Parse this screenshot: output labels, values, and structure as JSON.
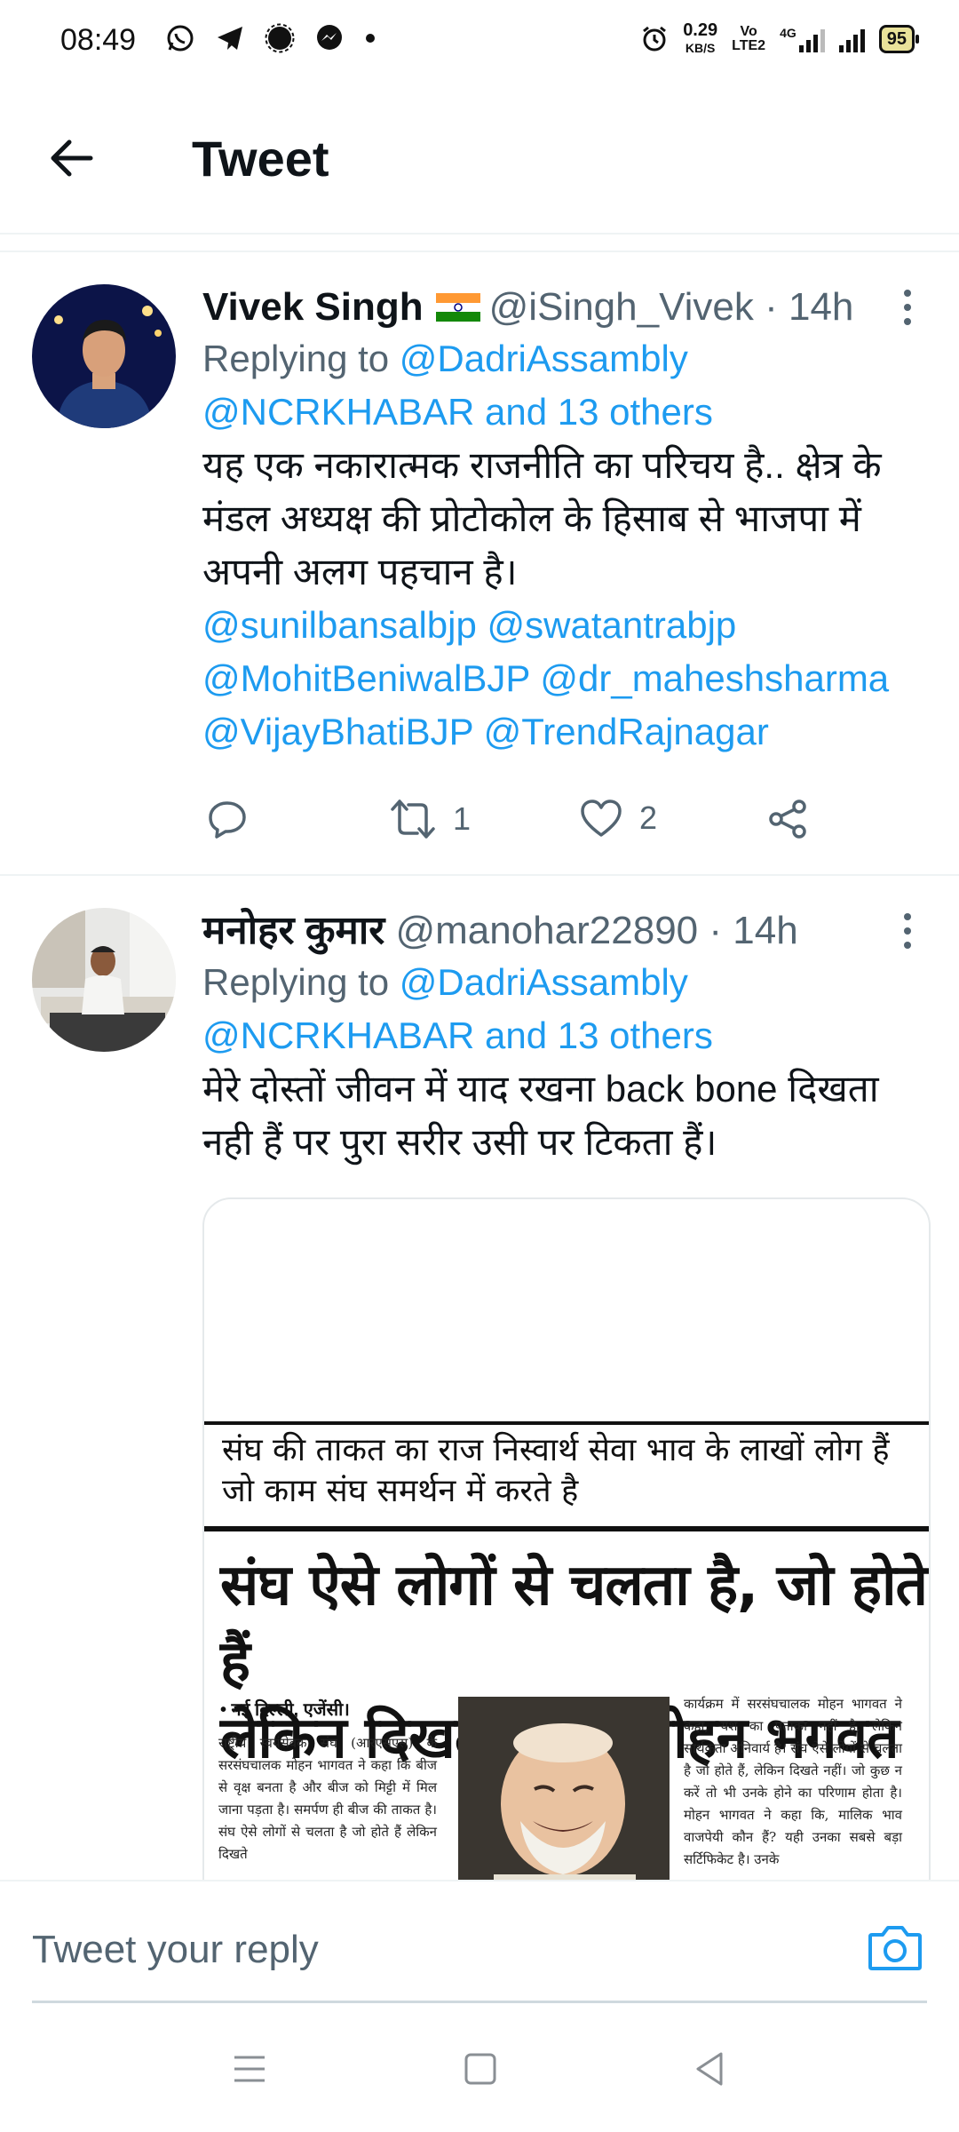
{
  "status_bar": {
    "time": "08:49",
    "left_icons": [
      "whatsapp-icon",
      "telegram-icon",
      "signal-icon",
      "messenger-icon",
      "dot-icon"
    ],
    "net_speed": "0.29",
    "net_unit": "KB/S",
    "network_labels": [
      "Vo",
      "LTE2",
      "4G"
    ],
    "battery": "95"
  },
  "header": {
    "title": "Tweet"
  },
  "tweets": [
    {
      "name": "Vivek Singh",
      "handle": "@iSingh_Vivek",
      "time": "· 14h",
      "replying_prefix": "Replying to",
      "reply_to_1": "@DadriAssambly",
      "reply_to_2": "@NCRKHABAR and 13 others",
      "text_lines": [
        "यह एक नकारात्मक राजनीति का परिचय है.. क्षेत्र के",
        "मंडल अध्यक्ष की प्रोटोकोल के हिसाब से भाजपा में",
        "अपनी अलग पहचान है।"
      ],
      "mentions": [
        "@sunilbansalbjp @swatantrabjp",
        "@MohitBeniwalBJP @dr_maheshsharma",
        "@VijayBhatiBJP @TrendRajnagar"
      ],
      "retweets": "1",
      "likes": "2"
    },
    {
      "name": "मनोहर कुमार",
      "handle": "@manohar22890",
      "time": "· 14h",
      "replying_prefix": "Replying to",
      "reply_to_1": "@DadriAssambly",
      "reply_to_2": "@NCRKHABAR and 13 others",
      "text_lines": [
        "मेरे दोस्तों जीवन में याद रखना back bone दिखता",
        "नही हैं पर पुरा सरीर उसी पर टिकता हैं।"
      ],
      "media": {
        "sub_line_1": "संघ की ताकत का राज निस्वार्थ सेवा भाव के लाखों लोग हैं",
        "sub_line_2": "जो काम संघ समर्थन में करते है",
        "headline_1": "संघ ऐसे लोगों से चलता है, जो होते हैं",
        "headline_2": "लेकिन दिखते नहीं : मोहन भगवत",
        "dateline": "• नई दिल्ली, एजेंसी।",
        "col_left": "राष्ट्रीय स्वयंसेवक संघ (आरएसएस) के सरसंघचालक मोहन भागवत ने कहा कि बीज से वृक्ष बनता है और बीज को मिट्टी में मिल जाना पड़ता है। समर्पण ही बीज की ताकत है। संघ ऐसे लोगों से चलता है जो होते हैं लेकिन दिखते",
        "col_right": "कार्यक्रम में सरसंघचालक मोहन भागवत ने कहा, यश का पताका नहीं है, लेकिन सार्थकता अनिवार्य है। संघ ऐसे लोगों से चलता है जो होते हैं, लेकिन दिखते नहीं। जो कुछ न करें तो भी उनके होने का परिणाम होता है। मोहन भागवत ने कहा कि, मालिक भाव वाजपेयी कौन हैं? यही उनका सबसे बड़ा सर्टिफिकेट है। उनके"
      }
    }
  ],
  "reply_bar": {
    "placeholder": "Tweet your reply"
  },
  "colors": {
    "link": "#1d9bf0",
    "secondary_text": "#536471",
    "divider": "#eff3f4"
  }
}
